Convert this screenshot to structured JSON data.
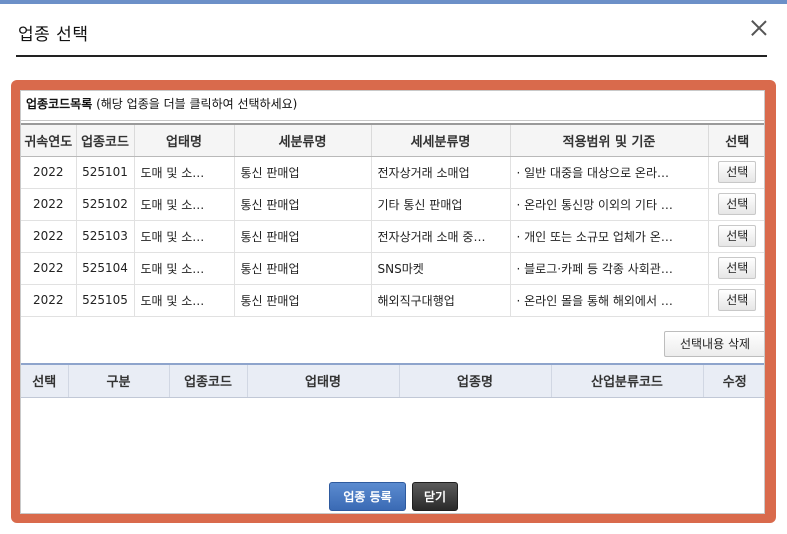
{
  "dialog": {
    "title": "업종 선택",
    "close_label": "×"
  },
  "list": {
    "caption_bold": "업종코드목록",
    "caption_note": "(해당 업종을 더블 클릭하여 선택하세요)",
    "columns": [
      "귀속연도",
      "업종코드",
      "업태명",
      "세분류명",
      "세세분류명",
      "적용범위 및 기준",
      "선택"
    ],
    "rows": [
      {
        "year": "2022",
        "code": "525101",
        "category": "도매 및 소…",
        "sub": "통신 판매업",
        "subsub": "전자상거래 소매업",
        "scope": "· 일반 대중을 대상으로 온라…",
        "select": "선택"
      },
      {
        "year": "2022",
        "code": "525102",
        "category": "도매 및 소…",
        "sub": "통신 판매업",
        "subsub": "기타 통신 판매업",
        "scope": "· 온라인 통신망 이외의 기타 …",
        "select": "선택"
      },
      {
        "year": "2022",
        "code": "525103",
        "category": "도매 및 소…",
        "sub": "통신 판매업",
        "subsub": "전자상거래 소매 중…",
        "scope": "· 개인 또는 소규모 업체가 온…",
        "select": "선택"
      },
      {
        "year": "2022",
        "code": "525104",
        "category": "도매 및 소…",
        "sub": "통신 판매업",
        "subsub": "SNS마켓",
        "scope": "· 블로그·카페 등 각종 사회관…",
        "select": "선택"
      },
      {
        "year": "2022",
        "code": "525105",
        "category": "도매 및 소…",
        "sub": "통신 판매업",
        "subsub": "해외직구대행업",
        "scope": "·  온라인 몰을 통해 해외에서 …",
        "select": "선택"
      }
    ]
  },
  "selected": {
    "delete_label": "선택내용 삭제",
    "columns": [
      "선택",
      "구분",
      "업종코드",
      "업태명",
      "업종명",
      "산업분류코드",
      "수정"
    ]
  },
  "footer": {
    "register_label": "업종 등록",
    "close_label": "닫기"
  },
  "colors": {
    "frame": "#d96a4c",
    "primary_button": "#3a6ab4",
    "dark_button": "#2a2a2a",
    "header_bg_selected": "#e9edf5"
  }
}
